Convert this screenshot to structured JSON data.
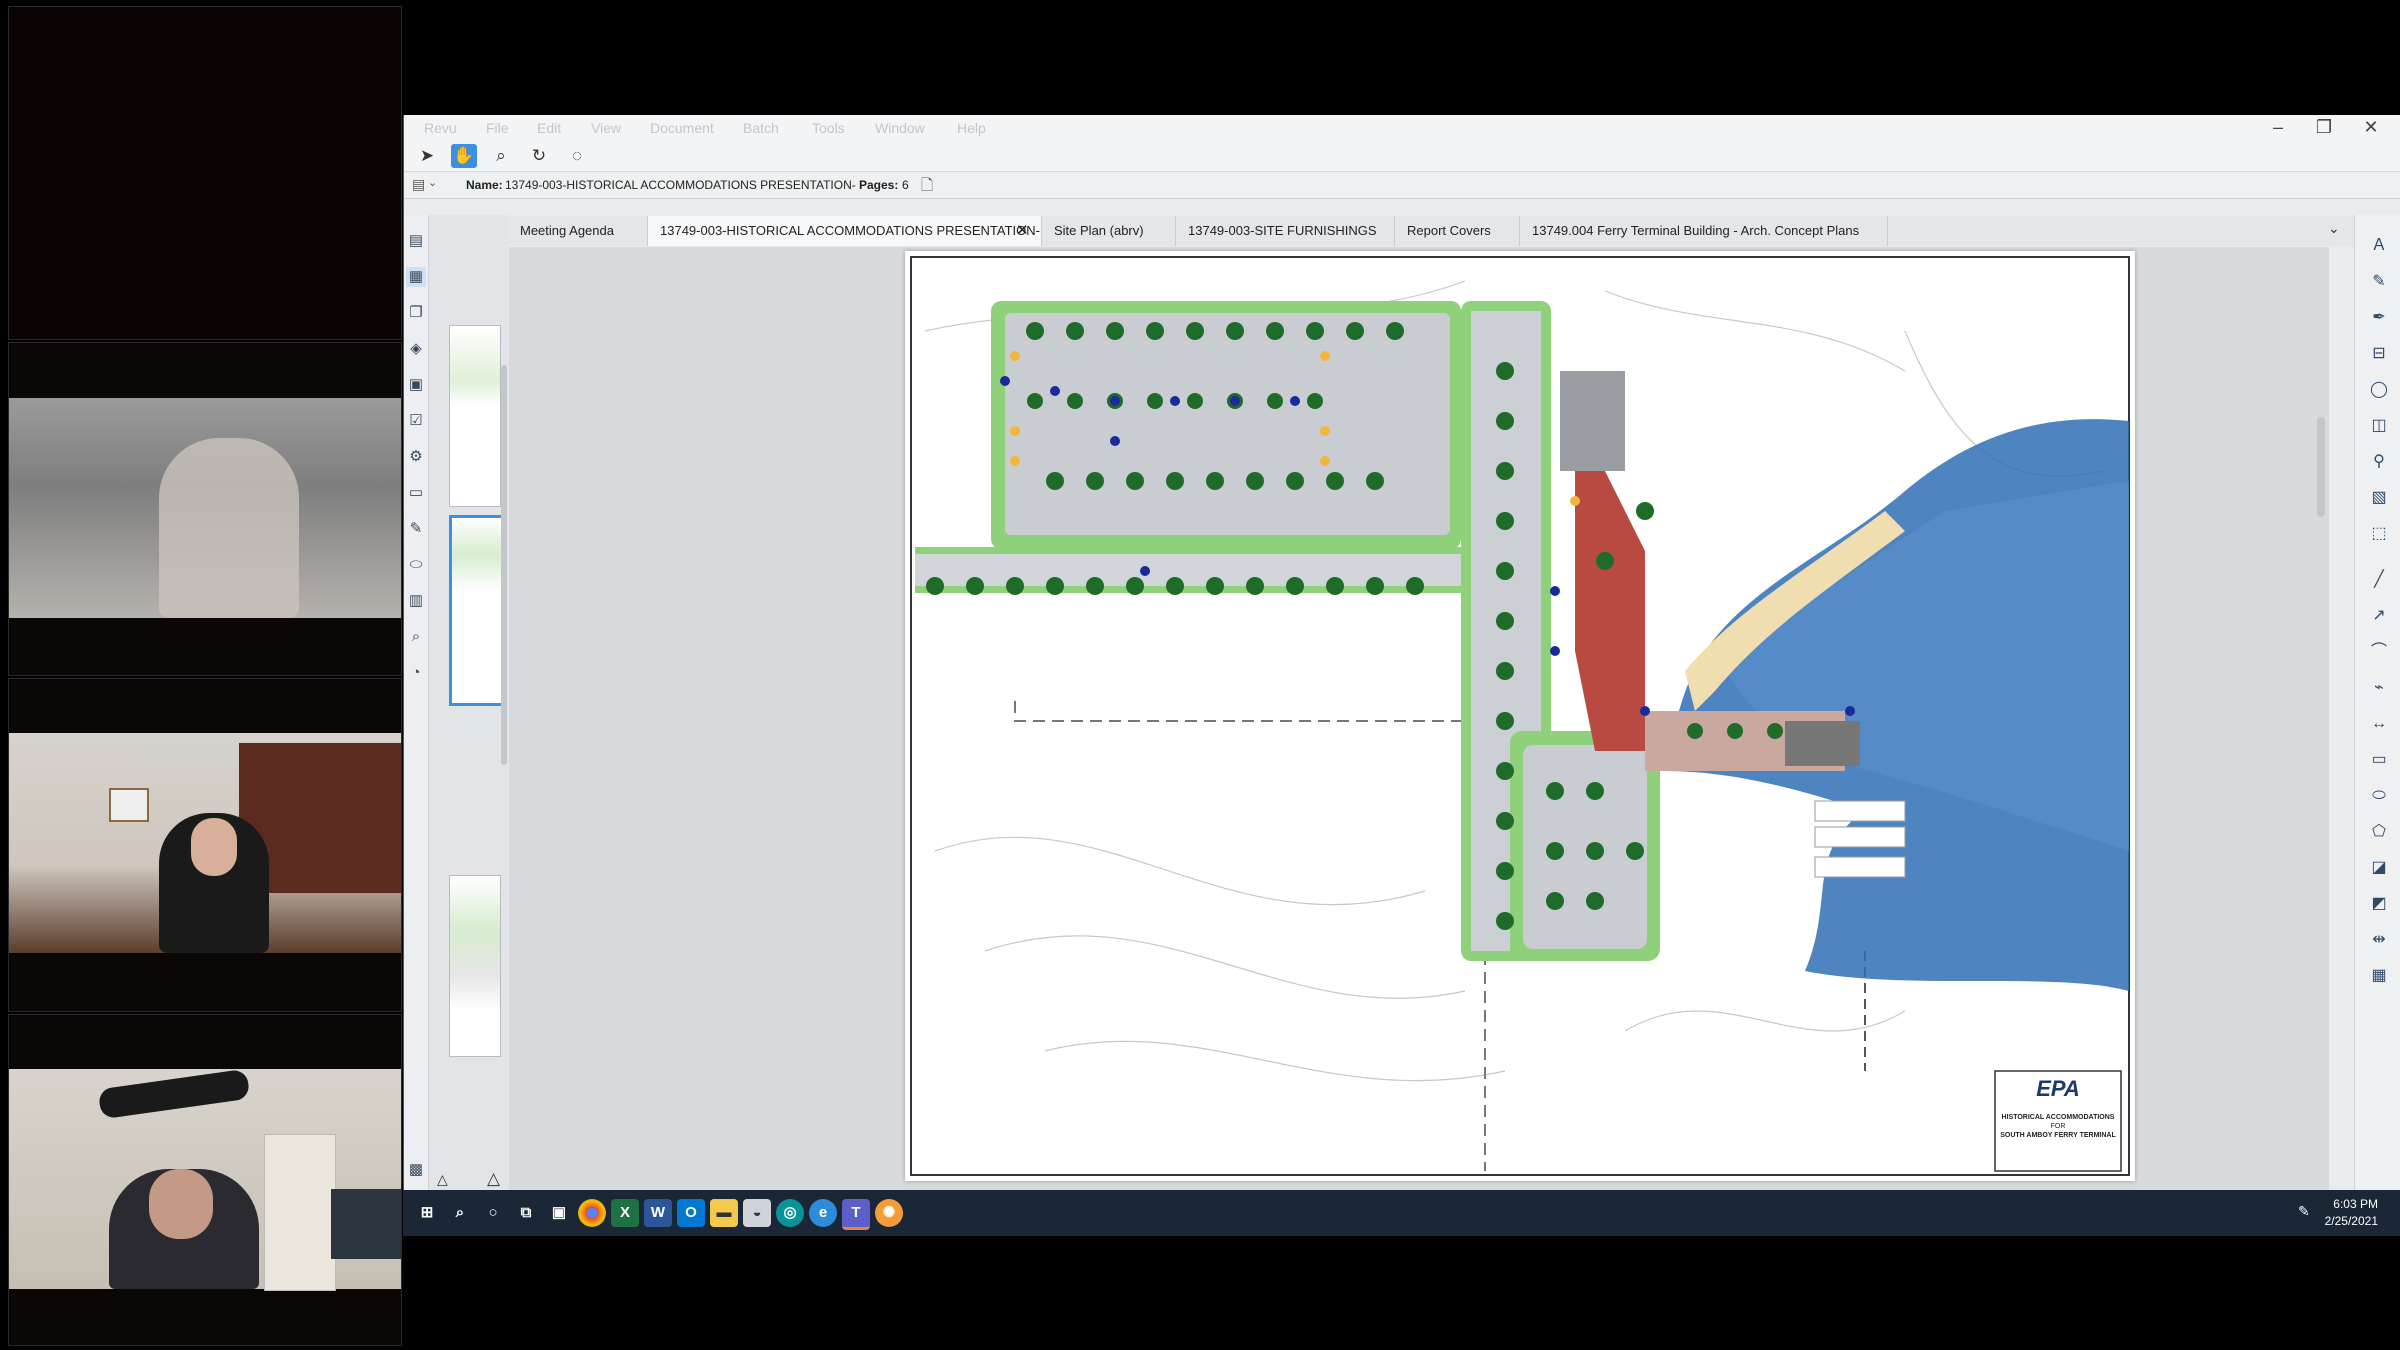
{
  "app": {
    "menu": [
      "Revu",
      "File",
      "Edit",
      "View",
      "Document",
      "Batch",
      "Tools",
      "Window",
      "Help"
    ],
    "window_controls": {
      "minimize": "–",
      "restore": "❐",
      "close": "✕"
    }
  },
  "document": {
    "name_label": "Name:",
    "name_value": "13749-003-HISTORICAL ACCOMMODATIONS PRESENTATION-",
    "pages_label": "Pages:",
    "pages_value": "6"
  },
  "tabs": [
    {
      "label": "Meeting Agenda"
    },
    {
      "label": "13749-003-HISTORICAL ACCOMMODATIONS PRESENTATION-",
      "active": true
    },
    {
      "label": "Site Plan (abrv)"
    },
    {
      "label": "13749-003-SITE FURNISHINGS"
    },
    {
      "label": "Report Covers"
    },
    {
      "label": "13749.004 Ferry Terminal Building - Arch. Concept Plans"
    }
  ],
  "title_block": {
    "logo": "EPA",
    "line1": "HISTORICAL ACCOMMODATIONS",
    "line2": "FOR",
    "line3": "SOUTH AMBOY FERRY TERMINAL"
  },
  "taskbar": {
    "time": "6:03 PM",
    "date": "2/25/2021",
    "apps": [
      "windows",
      "search",
      "cortana",
      "task-view",
      "store",
      "chrome",
      "excel",
      "word",
      "outlook",
      "file-explorer",
      "chat",
      "browser",
      "edge",
      "teams",
      "bluebeam"
    ]
  },
  "colors": {
    "taskbar": "#1b2637",
    "accent": "#3d8fe0",
    "water": "#2f6fb5",
    "paving": "#b94a42",
    "grass": "#8fd07a",
    "tree": "#1f6b2a"
  }
}
